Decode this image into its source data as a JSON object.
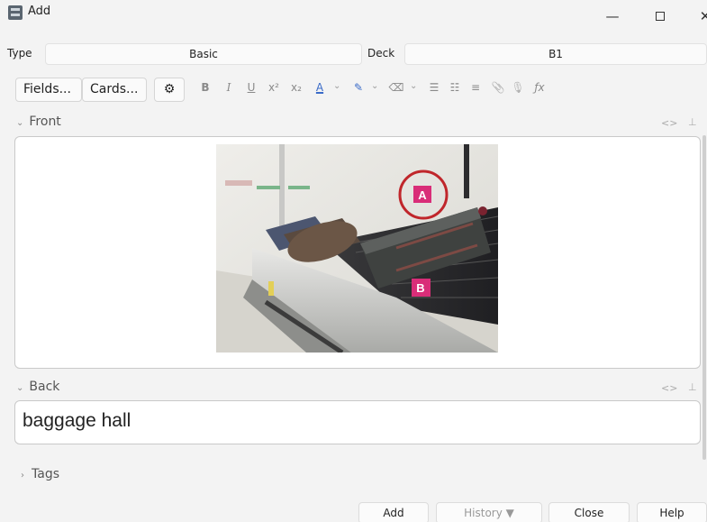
{
  "window": {
    "title": "Add",
    "minimize": "—",
    "close": "✕"
  },
  "type_row": {
    "type_label": "Type",
    "type_value": "Basic",
    "deck_label": "Deck",
    "deck_value": "B1"
  },
  "toolbar": {
    "fields_label": "Fields...",
    "cards_label": "Cards...",
    "gear_icon": "⚙",
    "bold": "B",
    "italic": "I",
    "underline": "U",
    "superscript": "x²",
    "subscript": "x₂",
    "text_color": "A",
    "dropdown": "⌄",
    "highlight": "✎",
    "eraser": "⌫",
    "bullet_list": "☰",
    "numbered_list": "☷",
    "align": "≡",
    "attach": "📎",
    "record": "🎙",
    "formula": "ƒx"
  },
  "front": {
    "label": "Front",
    "html_toggle": "<>",
    "pin": "⊥",
    "image_labels": [
      "A",
      "B"
    ]
  },
  "back": {
    "label": "Back",
    "html_toggle": "<>",
    "pin": "⊥",
    "value": "baggage hall"
  },
  "tags": {
    "label": "Tags"
  },
  "buttons": {
    "add": "Add",
    "history": "History ▼",
    "close": "Close",
    "help": "Help"
  },
  "colors": {
    "label_pink": "#d92d78",
    "circle_red": "#c0262b",
    "link_blue": "#3a6bc8"
  }
}
